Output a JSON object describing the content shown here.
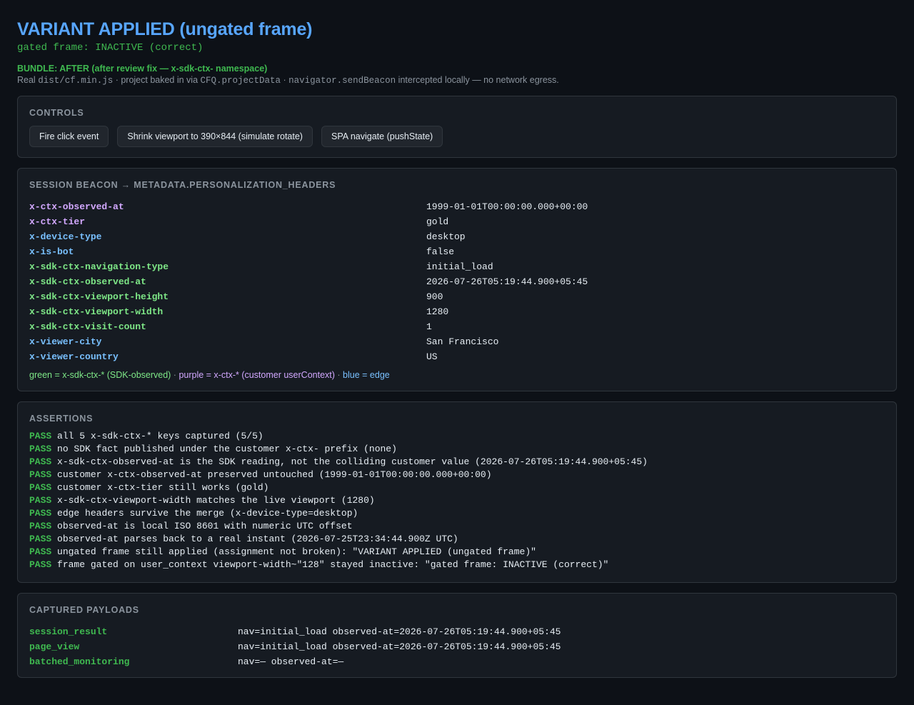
{
  "header": {
    "title": "VARIANT APPLIED (ungated frame)",
    "subtitle": "gated frame: INACTIVE (correct)",
    "bundle": "BUNDLE: AFTER (after review fix — x-sdk-ctx- namespace)",
    "desc_real": "Real ",
    "desc_file": "dist/cf.min.js",
    "desc_mid": " · project baked in via ",
    "desc_project": "CFQ.projectData",
    "desc_sep": " · ",
    "desc_beacon": "navigator.sendBeacon",
    "desc_tail": " intercepted locally — no network egress."
  },
  "controls": {
    "title": "CONTROLS",
    "buttons": [
      "Fire click event",
      "Shrink viewport to 390×844 (simulate rotate)",
      "SPA navigate (pushState)"
    ]
  },
  "beacon": {
    "title": "SESSION BEACON → METADATA.PERSONALIZATION_HEADERS",
    "rows": [
      {
        "key": "x-ctx-observed-at",
        "value": "1999-01-01T00:00:00.000+00:00",
        "kind": "customer"
      },
      {
        "key": "x-ctx-tier",
        "value": "gold",
        "kind": "customer"
      },
      {
        "key": "x-device-type",
        "value": "desktop",
        "kind": "edge"
      },
      {
        "key": "x-is-bot",
        "value": "false",
        "kind": "edge"
      },
      {
        "key": "x-sdk-ctx-navigation-type",
        "value": "initial_load",
        "kind": "sdk"
      },
      {
        "key": "x-sdk-ctx-observed-at",
        "value": "2026-07-26T05:19:44.900+05:45",
        "kind": "sdk"
      },
      {
        "key": "x-sdk-ctx-viewport-height",
        "value": "900",
        "kind": "sdk"
      },
      {
        "key": "x-sdk-ctx-viewport-width",
        "value": "1280",
        "kind": "sdk"
      },
      {
        "key": "x-sdk-ctx-visit-count",
        "value": "1",
        "kind": "sdk"
      },
      {
        "key": "x-viewer-city",
        "value": "San Francisco",
        "kind": "edge"
      },
      {
        "key": "x-viewer-country",
        "value": "US",
        "kind": "edge"
      }
    ],
    "legend": {
      "green": "green = x-sdk-ctx-* (SDK-observed)",
      "sep": " · ",
      "purple": "purple = x-ctx-* (customer userContext)",
      "blue": "blue = edge"
    },
    "colors": {
      "sdk": "#7ee787",
      "customer": "#d2a8ff",
      "edge": "#79c0ff"
    }
  },
  "assertions": {
    "title": "ASSERTIONS",
    "items": [
      {
        "status": "PASS",
        "text": "all 5 x-sdk-ctx-* keys captured (5/5)"
      },
      {
        "status": "PASS",
        "text": "no SDK fact published under the customer x-ctx- prefix (none)"
      },
      {
        "status": "PASS",
        "text": "x-sdk-ctx-observed-at is the SDK reading, not the colliding customer value (2026-07-26T05:19:44.900+05:45)"
      },
      {
        "status": "PASS",
        "text": "customer x-ctx-observed-at preserved untouched (1999-01-01T00:00:00.000+00:00)"
      },
      {
        "status": "PASS",
        "text": "customer x-ctx-tier still works (gold)"
      },
      {
        "status": "PASS",
        "text": "x-sdk-ctx-viewport-width matches the live viewport (1280)"
      },
      {
        "status": "PASS",
        "text": "edge headers survive the merge (x-device-type=desktop)"
      },
      {
        "status": "PASS",
        "text": "observed-at is local ISO 8601 with numeric UTC offset"
      },
      {
        "status": "PASS",
        "text": "observed-at parses back to a real instant (2026-07-25T23:34:44.900Z UTC)"
      },
      {
        "status": "PASS",
        "text": "ungated frame still applied (assignment not broken): \"VARIANT APPLIED (ungated frame)\""
      },
      {
        "status": "PASS",
        "text": "frame gated on user_context viewport-width~\"128\" stayed inactive: \"gated frame: INACTIVE (correct)\""
      }
    ]
  },
  "payloads": {
    "title": "CAPTURED PAYLOADS",
    "rows": [
      {
        "name": "session_result",
        "value": "nav=initial_load observed-at=2026-07-26T05:19:44.900+05:45"
      },
      {
        "name": "page_view",
        "value": "nav=initial_load observed-at=2026-07-26T05:19:44.900+05:45"
      },
      {
        "name": "batched_monitoring",
        "value": "nav=— observed-at=—"
      }
    ]
  }
}
